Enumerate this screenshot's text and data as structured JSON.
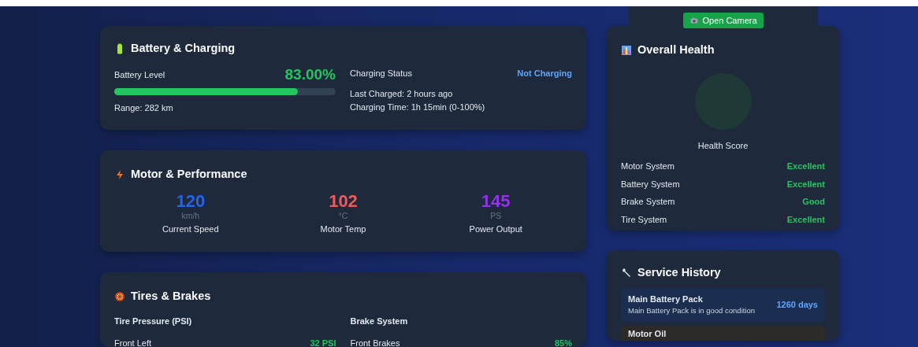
{
  "header": {
    "button": {
      "label": "Open Camera"
    }
  },
  "battery": {
    "title": "Battery & Charging",
    "level_label": "Battery Level",
    "percent": "83.00%",
    "level": 0.83,
    "range": "Range: 282 km",
    "status_label": "Charging Status",
    "status": "Not Charging",
    "last_charged": "Last Charged: 2 hours ago",
    "charging_time": "Charging Time: 1h 15min (0-100%)"
  },
  "motor": {
    "title": "Motor & Performance",
    "metrics": [
      {
        "value": "120",
        "unit": "km/h",
        "label": "Current Speed",
        "color": "#2563eb"
      },
      {
        "value": "102",
        "unit": "°C",
        "label": "Motor Temp",
        "color": "#f05a5a"
      },
      {
        "value": "145",
        "unit": "PS",
        "label": "Power Output",
        "color": "#9333ea"
      }
    ]
  },
  "tires": {
    "title": "Tires & Brakes",
    "pressure": {
      "heading": "Tire Pressure (PSI)",
      "rows": [
        {
          "name": "Front Left",
          "value": "32 PSI"
        }
      ]
    },
    "brakes": {
      "heading": "Brake System",
      "rows": [
        {
          "name": "Front Brakes",
          "value": "85%"
        }
      ]
    }
  },
  "health": {
    "title": "Overall Health",
    "score_label": "Health Score",
    "systems": [
      {
        "name": "Motor System",
        "rating": "Excellent"
      },
      {
        "name": "Battery System",
        "rating": "Excellent"
      },
      {
        "name": "Brake System",
        "rating": "Good"
      },
      {
        "name": "Tire System",
        "rating": "Excellent"
      }
    ]
  },
  "service": {
    "title": "Service History",
    "items": [
      {
        "kind": "good",
        "title": "Main Battery Pack",
        "subtitle": "Main Battery Pack is in good condition",
        "days": "1260 days"
      },
      {
        "kind": "warning",
        "title": "Motor Oil"
      }
    ]
  }
}
